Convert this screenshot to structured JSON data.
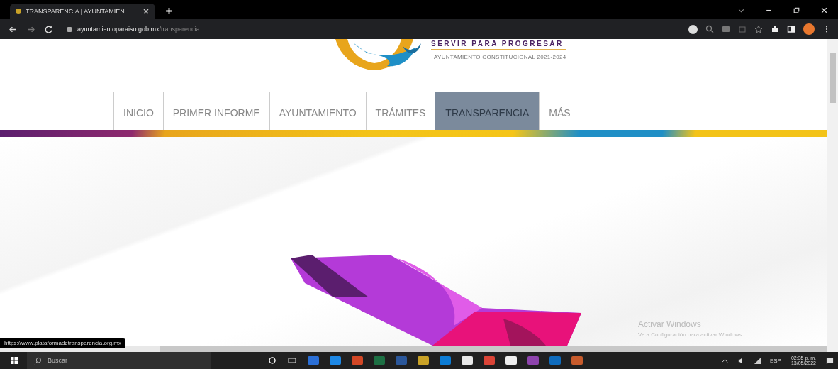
{
  "browser": {
    "tab_title": "TRANSPARENCIA | AYUNTAMIEN…",
    "url_host": "ayuntamientoparaiso.gob.mx",
    "url_path": "/transparencia"
  },
  "header": {
    "slogan": "SERVIR PARA PROGRESAR",
    "subtitle": "AYUNTAMIENTO CONSTITUCIONAL 2021-2024"
  },
  "nav": [
    {
      "label": "INICIO",
      "selected": false
    },
    {
      "label": "PRIMER INFORME",
      "selected": false
    },
    {
      "label": "AYUNTAMIENTO",
      "selected": false
    },
    {
      "label": "TRÁMITES",
      "selected": false
    },
    {
      "label": "TRANSPARENCIA",
      "selected": true
    },
    {
      "label": "MÁS",
      "selected": false
    }
  ],
  "status_url": "https://www.plataformadetransparencia.org.mx",
  "activation": {
    "title": "Activar Windows",
    "text": "Ve a Configuración para activar Windows."
  },
  "taskbar": {
    "search_placeholder": "Buscar",
    "language": "ESP",
    "time": "02:35 p. m.",
    "date": "13/05/2022"
  }
}
